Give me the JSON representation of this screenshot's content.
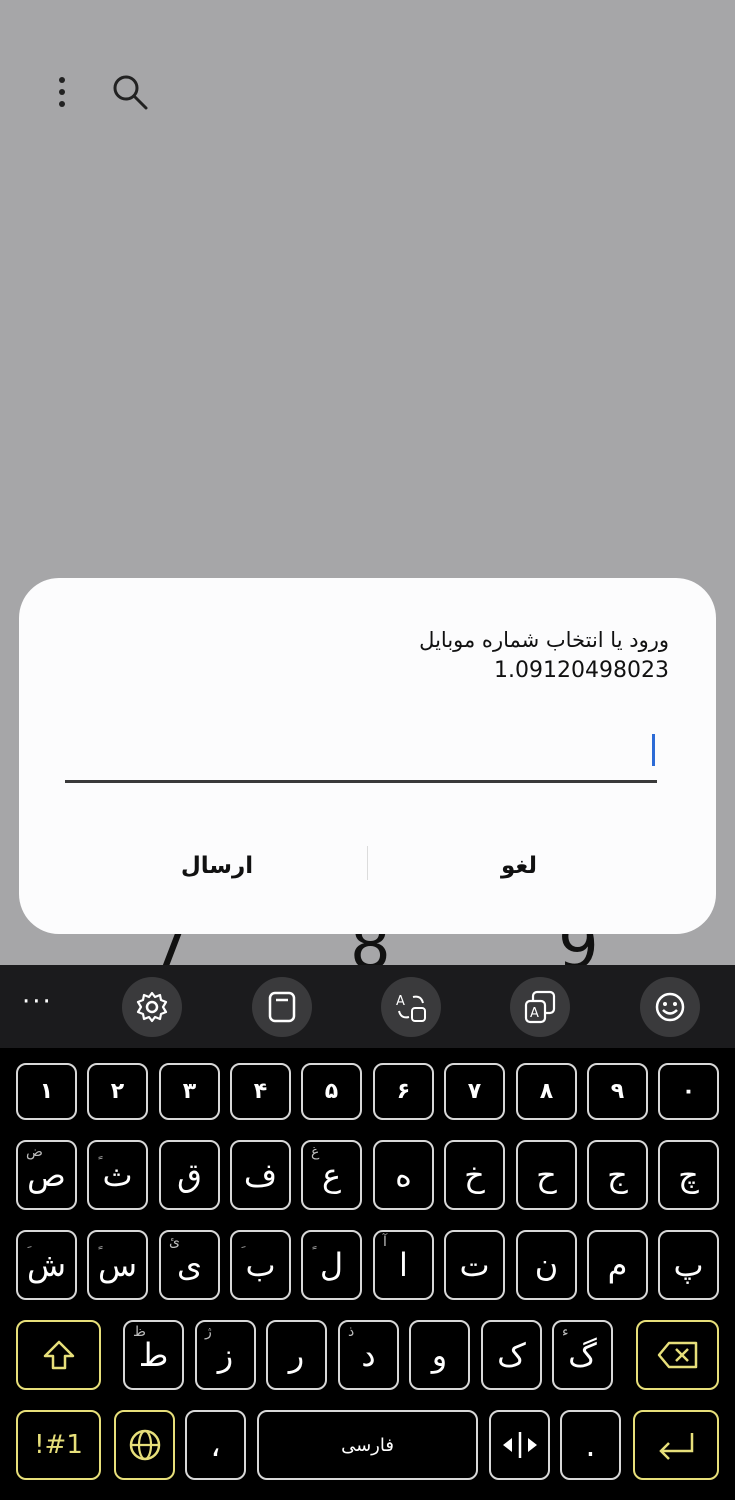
{
  "toolbar_top": {
    "menu_icon": "more-vert-icon",
    "search_icon": "search-icon"
  },
  "background_keys": [
    "7",
    "8",
    "9"
  ],
  "dialog": {
    "title": "ورود یا انتخاب شماره موبایل",
    "subtitle": "1.09120498023",
    "input_value": "",
    "send_label": "ارسال",
    "cancel_label": "لغو"
  },
  "keyboard": {
    "toolbar": [
      "more-icon",
      "settings-icon",
      "clipboard-icon",
      "translate-icon",
      "text-recognition-icon",
      "emoji-icon"
    ],
    "more_label": "···",
    "row_numbers": [
      "۱",
      "۲",
      "۳",
      "۴",
      "۵",
      "۶",
      "۷",
      "۸",
      "۹",
      "۰"
    ],
    "row1": [
      {
        "key": "ص",
        "hint": "ض"
      },
      {
        "key": "ث",
        "hint": "ٍ"
      },
      {
        "key": "ق",
        "hint": ""
      },
      {
        "key": "ف",
        "hint": ""
      },
      {
        "key": "ع",
        "hint": "غ"
      },
      {
        "key": "ه",
        "hint": ""
      },
      {
        "key": "خ",
        "hint": ""
      },
      {
        "key": "ح",
        "hint": ""
      },
      {
        "key": "ج",
        "hint": ""
      },
      {
        "key": "چ",
        "hint": ""
      }
    ],
    "row2": [
      {
        "key": "ش",
        "hint": "ِ"
      },
      {
        "key": "س",
        "hint": "ٍ"
      },
      {
        "key": "ی",
        "hint": "ئ"
      },
      {
        "key": "ب",
        "hint": "ِ"
      },
      {
        "key": "ل",
        "hint": "ٍ"
      },
      {
        "key": "ا",
        "hint": "آ"
      },
      {
        "key": "ت",
        "hint": ""
      },
      {
        "key": "ن",
        "hint": ""
      },
      {
        "key": "م",
        "hint": ""
      },
      {
        "key": "پ",
        "hint": ""
      }
    ],
    "row3": [
      {
        "key": "ط",
        "hint": "ظ"
      },
      {
        "key": "ز",
        "hint": "ژ"
      },
      {
        "key": "ر",
        "hint": ""
      },
      {
        "key": "د",
        "hint": "ذ"
      },
      {
        "key": "و",
        "hint": ""
      },
      {
        "key": "ک",
        "hint": ""
      },
      {
        "key": "گ",
        "hint": "ء"
      }
    ],
    "symbols_label": "!#1",
    "comma_label": "،",
    "space_label": "فارسی",
    "period_label": "."
  }
}
